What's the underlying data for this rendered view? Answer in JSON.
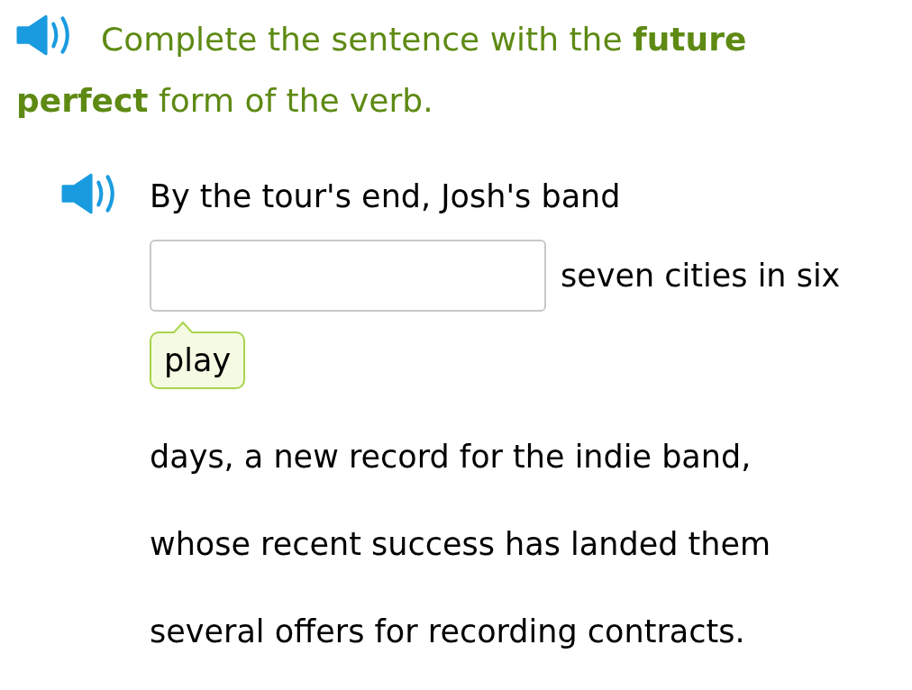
{
  "instruction": "Complete the sentence with the **future perfect** form of the verb.",
  "sentence": {
    "before": "By the tour's end, Josh's band",
    "after": "seven cities in six",
    "hint": "play",
    "lines": [
      "days, a new record for the indie band,",
      "whose recent success has landed them",
      "several offers for recording contracts."
    ]
  }
}
